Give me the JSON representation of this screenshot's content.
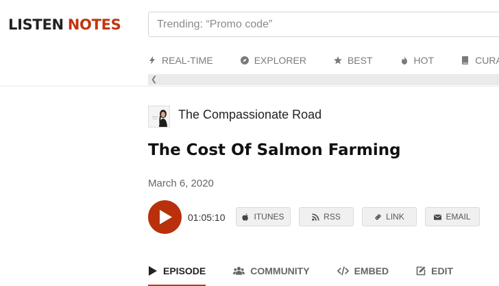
{
  "logo": {
    "part1": "LISTEN",
    "part2": "NOTES"
  },
  "search": {
    "placeholder": "Trending: “Promo code”"
  },
  "nav": {
    "items": [
      {
        "label": "REAL-TIME",
        "icon": "bolt-icon"
      },
      {
        "label": "EXPLORER",
        "icon": "compass-icon"
      },
      {
        "label": "BEST",
        "icon": "star-icon"
      },
      {
        "label": "HOT",
        "icon": "fire-icon"
      },
      {
        "label": "CURATED",
        "icon": "book-icon"
      }
    ]
  },
  "podcast": {
    "title": "The Compassionate Road"
  },
  "episode": {
    "title": "The Cost Of Salmon Farming",
    "date": "March 6, 2020",
    "duration": "01:05:10"
  },
  "actions": {
    "itunes": "ITUNES",
    "rss": "RSS",
    "link": "LINK",
    "email": "EMAIL"
  },
  "tabs": {
    "episode": "EPISODE",
    "community": "COMMUNITY",
    "embed": "EMBED",
    "edit": "EDIT"
  },
  "colors": {
    "brand": "#c2350f",
    "play": "#b8310c"
  }
}
